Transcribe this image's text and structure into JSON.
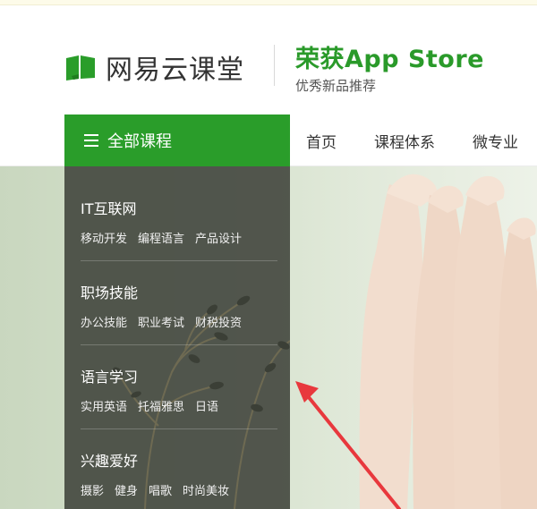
{
  "header": {
    "logo_text": "网易云课堂",
    "award_title": "荣获App Store",
    "award_subtitle": "优秀新品推荐"
  },
  "nav": {
    "all_courses_label": "全部课程",
    "links": [
      "首页",
      "课程体系",
      "微专业"
    ]
  },
  "sidebar": {
    "categories": [
      {
        "title": "IT互联网",
        "subs": [
          "移动开发",
          "编程语言",
          "产品设计"
        ]
      },
      {
        "title": "职场技能",
        "subs": [
          "办公技能",
          "职业考试",
          "财税投资"
        ]
      },
      {
        "title": "语言学习",
        "subs": [
          "实用英语",
          "托福雅思",
          "日语"
        ]
      },
      {
        "title": "兴趣爱好",
        "subs": [
          "摄影",
          "健身",
          "唱歌",
          "时尚美妆"
        ]
      }
    ]
  },
  "colors": {
    "brand_green": "#2a9d2a",
    "sidebar_bg": "#464a42",
    "annotation_arrow": "#e8383d"
  }
}
